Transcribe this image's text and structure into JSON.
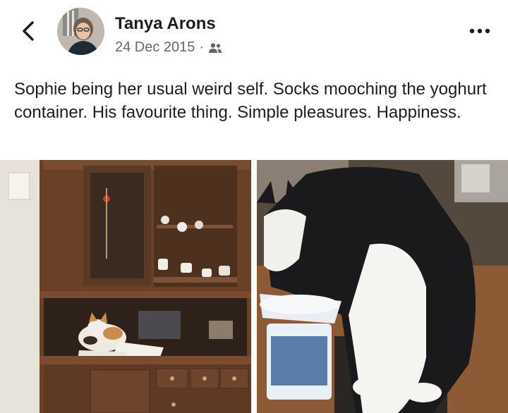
{
  "post": {
    "author": "Tanya Arons",
    "date": "24 Dec 2015",
    "separator": "·",
    "audience_icon": "friends-icon",
    "caption": "Sophie being her usual weird self.  Socks mooching the yoghurt container.  His favourite thing.  Simple pleasures. Happiness."
  },
  "nav": {
    "back_icon": "back-chevron-icon",
    "more_icon": "more-options-icon"
  },
  "photos": [
    {
      "subject": "photo-sophie-cabinet"
    },
    {
      "subject": "photo-socks-yoghurt"
    }
  ],
  "colors": {
    "text_primary": "#1c1e21",
    "text_secondary": "#65676b",
    "background": "#ffffff"
  }
}
